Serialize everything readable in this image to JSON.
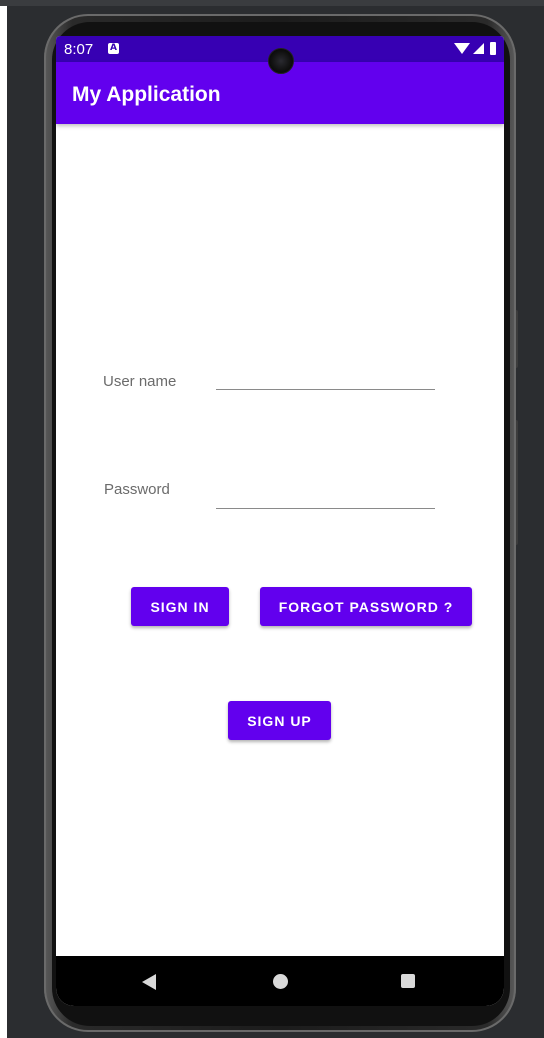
{
  "status_bar": {
    "time": "8:07",
    "notification_letter": "A",
    "icons": [
      "wifi-icon",
      "signal-icon",
      "battery-icon"
    ]
  },
  "app_bar": {
    "title": "My Application"
  },
  "form": {
    "username_label": "User name",
    "username_value": "",
    "password_label": "Password",
    "password_value": ""
  },
  "buttons": {
    "sign_in": "SIGN IN",
    "forgot_password": "FORGOT PASSWORD ?",
    "sign_up": "SIGN UP"
  },
  "nav_bar": {
    "icons": [
      "back-icon",
      "home-icon",
      "recents-icon"
    ]
  },
  "colors": {
    "primary": "#6200ee",
    "primary_dark": "#3700b3",
    "label": "#6b6b6b"
  }
}
